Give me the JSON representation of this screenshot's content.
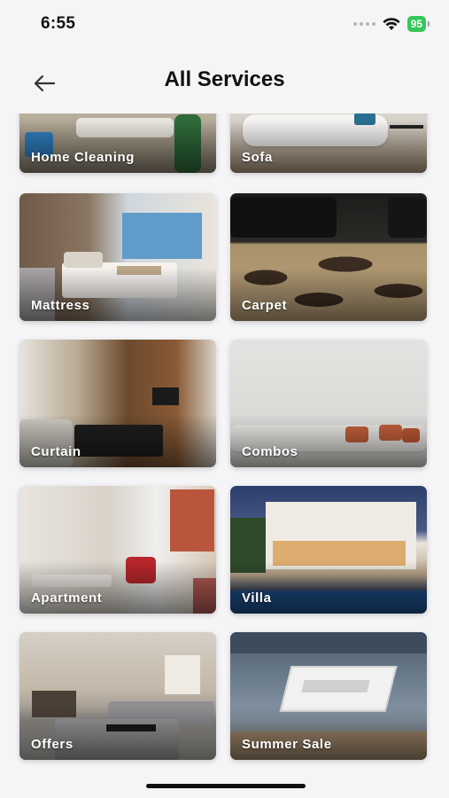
{
  "status": {
    "time": "6:55",
    "battery": "95"
  },
  "header": {
    "title": "All Services"
  },
  "services": [
    {
      "label": "Home Cleaning"
    },
    {
      "label": "Sofa"
    },
    {
      "label": "Mattress"
    },
    {
      "label": "Carpet"
    },
    {
      "label": "Curtain"
    },
    {
      "label": "Combos"
    },
    {
      "label": "Apartment"
    },
    {
      "label": "Villa"
    },
    {
      "label": "Offers"
    },
    {
      "label": "Summer Sale"
    }
  ]
}
